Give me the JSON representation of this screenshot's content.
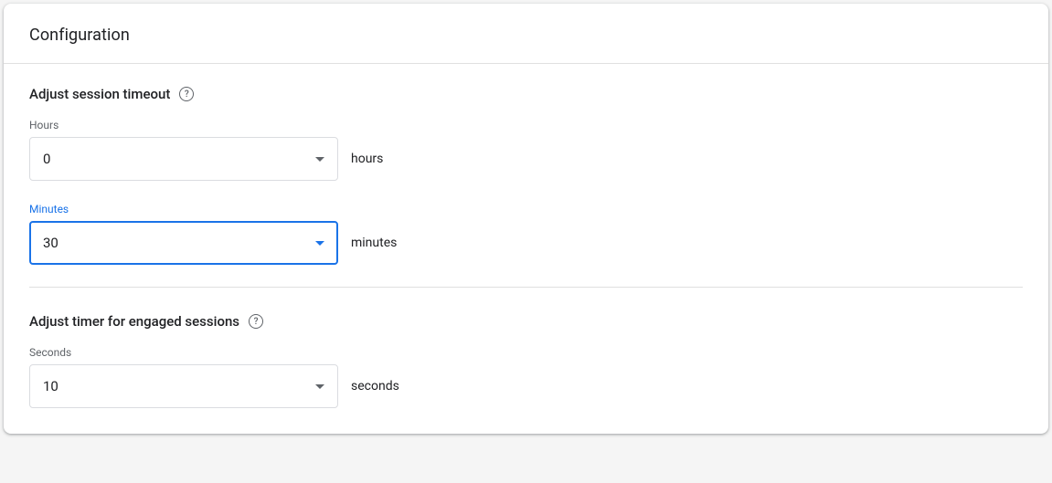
{
  "card": {
    "title": "Configuration"
  },
  "sessionTimeout": {
    "title": "Adjust session timeout",
    "hours": {
      "label": "Hours",
      "value": "0",
      "unit": "hours"
    },
    "minutes": {
      "label": "Minutes",
      "value": "30",
      "unit": "minutes"
    }
  },
  "engagedTimer": {
    "title": "Adjust timer for engaged sessions",
    "seconds": {
      "label": "Seconds",
      "value": "10",
      "unit": "seconds"
    }
  }
}
